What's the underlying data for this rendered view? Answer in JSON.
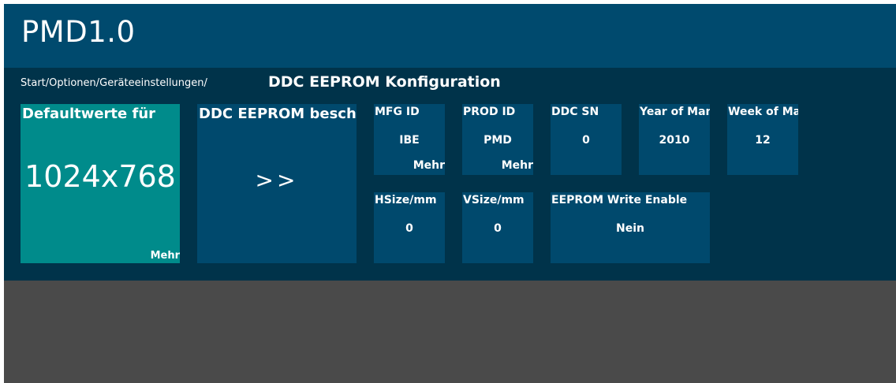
{
  "app": {
    "title": "PMD1.0"
  },
  "breadcrumb": {
    "path": "Start/Optionen/Geräteeinstellungen/",
    "current": "DDC EEPROM Konfiguration"
  },
  "tiles": {
    "defaults": {
      "title": "Defaultwerte für",
      "value": "1024x768",
      "more": "Mehr"
    },
    "describe": {
      "title": "DDC EEPROM beschreiben",
      "action": ">>"
    },
    "mfg_id": {
      "label": "MFG ID",
      "value": "IBE",
      "more": "Mehr"
    },
    "prod_id": {
      "label": "PROD ID",
      "value": "PMD",
      "more": "Mehr"
    },
    "ddc_sn": {
      "label": "DDC SN",
      "value": "0"
    },
    "year": {
      "label": "Year of Manufacture",
      "value": "2010"
    },
    "week": {
      "label": "Week of Manufacture",
      "value": "12"
    },
    "hsize": {
      "label": "HSize/mm",
      "value": "0"
    },
    "vsize": {
      "label": "VSize/mm",
      "value": "0"
    },
    "write_enable": {
      "label": "EEPROM Write Enable",
      "value": "Nein"
    }
  },
  "colors": {
    "header": "#004a6e",
    "panel": "#00334a",
    "tile": "#00496d",
    "accent_tile": "#008b8b",
    "background": "#4a4a4a"
  }
}
